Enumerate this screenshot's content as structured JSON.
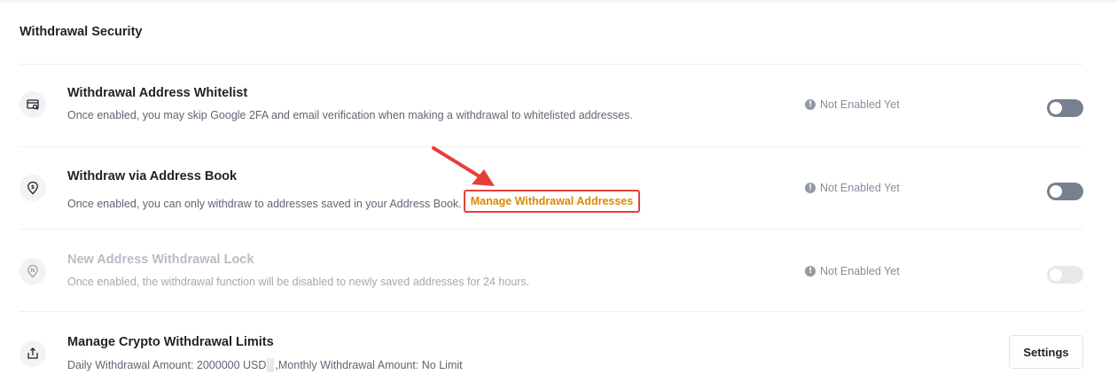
{
  "section": {
    "title": "Withdrawal Security"
  },
  "rows": [
    {
      "icon": "whitelist-card-icon",
      "title": "Withdrawal Address Whitelist",
      "description": "Once enabled, you may skip Google 2FA and email verification when making a withdrawal to whitelisted addresses.",
      "status": "Not Enabled Yet",
      "toggle": "off"
    },
    {
      "icon": "address-book-pin-icon",
      "title": "Withdraw via Address Book",
      "description": "Once enabled, you can only withdraw to addresses saved in your Address Book.",
      "link": "Manage Withdrawal Addresses",
      "status": "Not Enabled Yet",
      "toggle": "off"
    },
    {
      "icon": "new-address-lock-icon",
      "title": "New Address Withdrawal Lock",
      "description": "Once enabled, the withdrawal function will be disabled to newly saved addresses for 24 hours.",
      "status": "Not Enabled Yet",
      "toggle": "off-disabled"
    },
    {
      "icon": "upload-tray-icon",
      "title": "Manage Crypto Withdrawal Limits",
      "description_part1": "Daily Withdrawal Amount: 2000000 USD",
      "description_part2": ",Monthly Withdrawal Amount: No Limit",
      "button": "Settings"
    }
  ],
  "colors": {
    "link": "#d98a00",
    "highlight_box": "#e63f3a",
    "toggle_off": "#76808f",
    "toggle_disabled": "#e6e8ea"
  }
}
